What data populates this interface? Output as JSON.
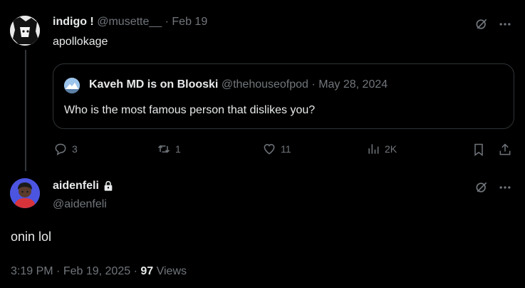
{
  "tweet1": {
    "name": "indigo !",
    "handle": "@musette__",
    "separator": "·",
    "date": "Feb 19",
    "text": "apollokage",
    "quote": {
      "name": "Kaveh MD is on Blooski",
      "handle": "@thehouseofpod",
      "separator": "·",
      "date": "May 28, 2024",
      "text": "Who is the most famous person that dislikes you?"
    },
    "actions": {
      "replies": "3",
      "reposts": "1",
      "likes": "11",
      "views": "2K"
    }
  },
  "tweet2": {
    "name": "aidenfeli",
    "handle": "@aidenfeli",
    "text": "onin lol",
    "time": "3:19 PM",
    "separator1": "·",
    "date": "Feb 19, 2025",
    "separator2": "·",
    "views_count": "97",
    "views_label": "Views"
  },
  "icons": {
    "grok": "grok-icon",
    "more": "more-icon",
    "reply": "reply-icon",
    "repost": "repost-icon",
    "like": "like-icon",
    "views": "views-icon",
    "bookmark": "bookmark-icon",
    "share": "share-icon",
    "lock": "lock-icon"
  }
}
